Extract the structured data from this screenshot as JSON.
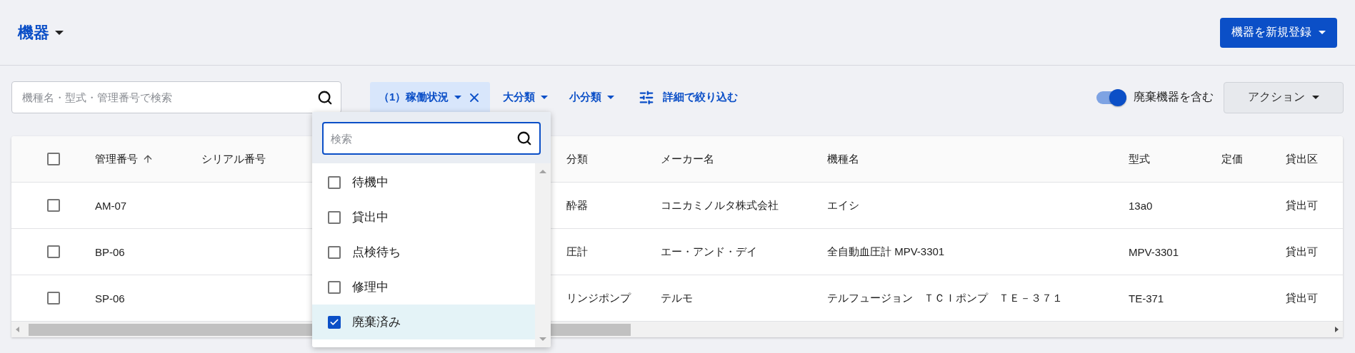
{
  "page_title": "機器",
  "new_button": "機器を新規登録",
  "search": {
    "placeholder": "機種名・型式・管理番号で検索"
  },
  "filters": [
    {
      "label": "（1）稼働状況",
      "active": true
    },
    {
      "label": "大分類",
      "active": false
    },
    {
      "label": "小分類",
      "active": false
    }
  ],
  "advanced_filter": "詳細で絞り込む",
  "include_discarded": {
    "label": "廃棄機器を含む",
    "on": true
  },
  "action_button": "アクション",
  "table": {
    "all_checked": false,
    "columns": [
      {
        "label": "管理番号",
        "sorted_ascending": true
      },
      {
        "label": "シリアル番号"
      },
      {
        "label": "分類"
      },
      {
        "label": "メーカー名"
      },
      {
        "label": "機種名"
      },
      {
        "label": "型式"
      },
      {
        "label": "定価"
      },
      {
        "label": "貸出区"
      }
    ],
    "rows": [
      {
        "checked": false,
        "management_number": "AM-07",
        "category": "酔器",
        "maker": "コニカミノルタ株式会社",
        "model_name": "エイシ",
        "model": "13a0",
        "loan": "貸出可"
      },
      {
        "checked": false,
        "management_number": "BP-06",
        "category": "圧計",
        "maker": "エー・アンド・デイ",
        "model_name": "全自動血圧計 MPV-3301",
        "model": "MPV-3301",
        "loan": "貸出可"
      },
      {
        "checked": false,
        "management_number": "SP-06",
        "category": "リンジポンプ",
        "maker": "テルモ",
        "model_name": "テルフュージョン　ＴＣＩポンプ　ＴＥ－３７１",
        "model": "TE-371",
        "loan": "貸出可"
      }
    ]
  },
  "status_dropdown": {
    "search_placeholder": "検索",
    "options": [
      {
        "label": "待機中",
        "checked": false
      },
      {
        "label": "貸出中",
        "checked": false
      },
      {
        "label": "点検待ち",
        "checked": false
      },
      {
        "label": "修理中",
        "checked": false
      },
      {
        "label": "廃棄済み",
        "checked": true
      }
    ]
  }
}
